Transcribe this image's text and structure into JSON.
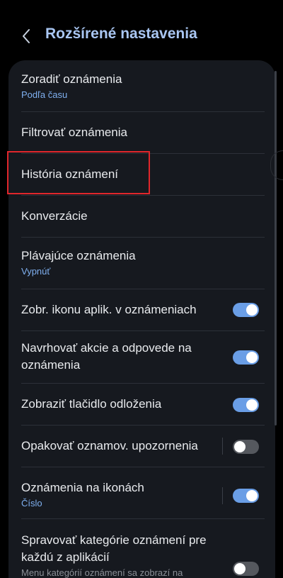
{
  "header": {
    "back_icon": "chevron-left-icon",
    "title": "Rozšírené nastavenia"
  },
  "colors": {
    "title": "#a9c6f2",
    "accent": "#6a9ee6",
    "panel": "#16191f",
    "highlight": "#e0262b"
  },
  "settings": [
    {
      "title": "Zoradiť oznámenia",
      "subtitle": "Podľa času"
    },
    {
      "title": "Filtrovať oznámenia"
    },
    {
      "title": "História oznámení",
      "highlighted": true
    },
    {
      "title": "Konverzácie"
    },
    {
      "title": "Plávajúce oznámenia",
      "subtitle": "Vypnúť"
    },
    {
      "title": "Zobr. ikonu aplik. v oznámeniach",
      "toggle": true
    },
    {
      "title": "Navrhovať akcie a odpovede na oznámenia",
      "toggle": true
    },
    {
      "title": "Zobraziť tlačidlo odloženia",
      "toggle": true
    },
    {
      "title": "Opakovať oznamov. upozornenia",
      "toggle": false
    },
    {
      "title": "Oznámenia na ikonách",
      "subtitle": "Číslo",
      "toggle": true
    },
    {
      "title": "Spravovať kategórie oznámení pre každú z aplikácií",
      "subtitle": "Menu kategórií oznámení sa zobrazí na",
      "toggle": false
    }
  ]
}
